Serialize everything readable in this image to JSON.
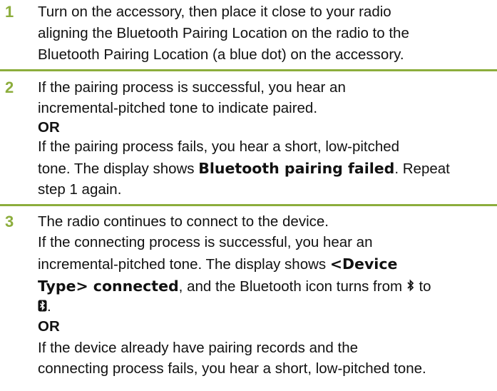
{
  "steps": [
    {
      "number": "1",
      "lines": [
        "Turn on the accessory, then place it close to your radio",
        "aligning the Bluetooth Pairing Location on the radio to the",
        "Bluetooth Pairing Location (a blue dot) on the accessory."
      ]
    },
    {
      "number": "2",
      "line1": "If the pairing process is successful, you hear an",
      "line2": "incremental-pitched tone to indicate paired.",
      "or": "OR",
      "line4": "If the pairing process fails, you hear a short, low-pitched",
      "line5_pre": "tone. The display shows ",
      "line5_display": "Bluetooth pairing failed",
      "line5_post": ". Repeat",
      "line6": "step 1 again."
    },
    {
      "number": "3",
      "line1": "The radio continues to connect to the device.",
      "line2": "If the connecting process is successful, you hear an",
      "line3_pre": "incremental-pitched tone. The display shows ",
      "line3_display": "<Device",
      "line4_display": "Type> connected",
      "line4_post": ", and the Bluetooth icon turns from ",
      "line4_end": " to",
      "line5_post": ".",
      "or": "OR",
      "line7": "If the device already have pairing records and the",
      "line8": "connecting process fails, you hear a short, low-pitched tone."
    }
  ],
  "icons": [
    "bluetooth-icon",
    "bluetooth-connected-icon"
  ],
  "colors": {
    "step_number": "#8cad3c",
    "rule": "#8cad3c"
  }
}
